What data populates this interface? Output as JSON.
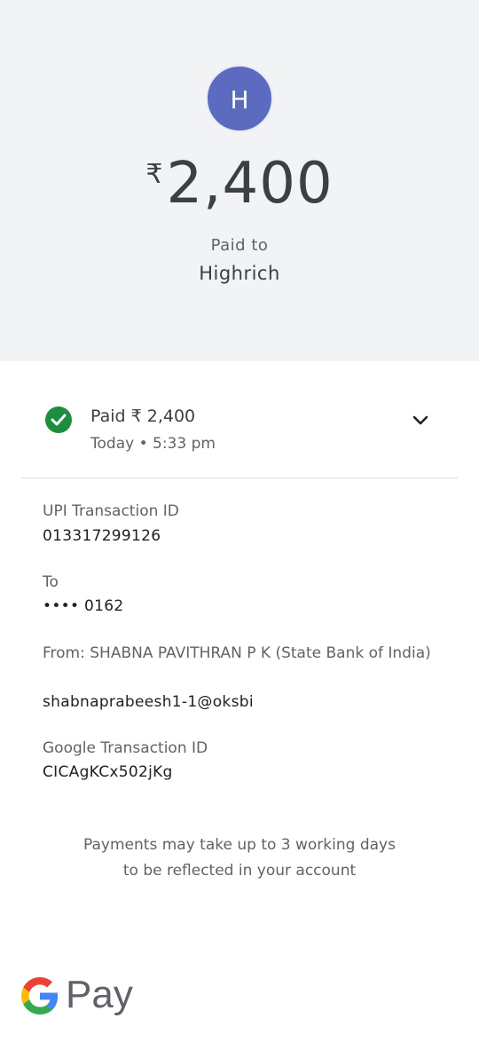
{
  "header": {
    "avatar_initial": "H",
    "avatar_color": "#5c6bc0",
    "currency_symbol": "₹",
    "amount": "2,400",
    "paid_to_label": "Paid to",
    "payee_name": "Highrich"
  },
  "status": {
    "icon": "check-circle-icon",
    "title": "Paid ₹ 2,400",
    "time": "Today • 5:33 pm",
    "expand_icon": "chevron-down-icon",
    "status_color": "#1e8e3e"
  },
  "details": {
    "upi_label": "UPI Transaction ID",
    "upi_value": "013317299126",
    "to_label": "To",
    "to_value": "•••• 0162",
    "from_label": "From: SHABNA PAVITHRAN  P K (State Bank of India)",
    "from_value": "shabnaprabeesh1-1@oksbi",
    "google_label": "Google Transaction ID",
    "google_value": "CICAgKCx502jKg"
  },
  "note": {
    "line1": "Payments may take up to 3 working days",
    "line2": "to be reflected in your account"
  },
  "brand": {
    "logo_icon": "google-g-icon",
    "pay_text": "Pay"
  }
}
